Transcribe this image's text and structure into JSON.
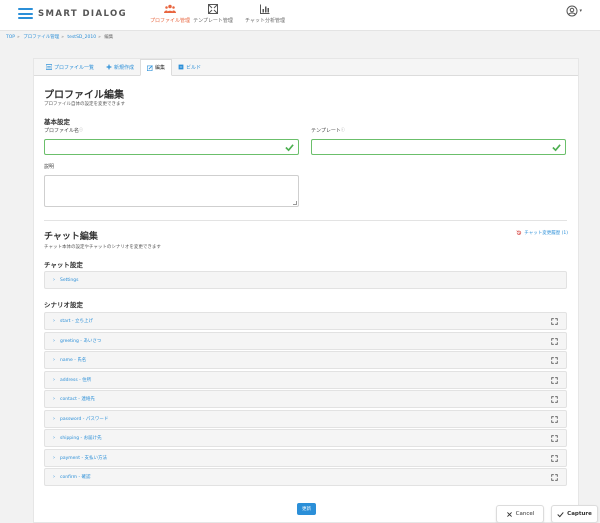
{
  "header": {
    "logo_text": "SMART DIALOG",
    "nav": [
      {
        "label": "プロファイル管理",
        "icon": "users-icon",
        "active": true
      },
      {
        "label": "テンプレート管理",
        "icon": "template-icon",
        "active": false
      },
      {
        "label": "チャット分析管理",
        "icon": "chart-icon",
        "active": false
      }
    ],
    "user_icon": "user-circle-icon",
    "accent_color": "#e8653f",
    "link_color": "#2b8fd8"
  },
  "breadcrumb": {
    "items": [
      "TOP",
      "プロファイル管理",
      "testSD_2010",
      "編集"
    ],
    "separator": "»"
  },
  "tabs": [
    {
      "label": "プロファイル一覧",
      "icon": "list-icon"
    },
    {
      "label": "新規作成",
      "icon": "plus-icon"
    },
    {
      "label": "編集",
      "icon": "edit-icon",
      "active": true
    },
    {
      "label": "ビルド",
      "icon": "build-icon"
    }
  ],
  "profile": {
    "title": "プロファイル編集",
    "description": "プロファイル自体の設定を変更できます",
    "basic_settings": "基本設定",
    "name_label": "プロファイル名",
    "template_label": "テンプレート",
    "info_mark": "ⓘ",
    "name_value": "",
    "template_value": "",
    "desc_label": "説明",
    "desc_value": ""
  },
  "chat": {
    "title": "チャット編集",
    "description": "チャット本体の設定やチャットのシナリオを変更できます",
    "history_label": "チャット変更履歴 (1)",
    "chat_settings": "チャット設定",
    "settings_item": "Settings",
    "scenario_settings": "シナリオ設定",
    "scenarios": [
      "start - 立ち上げ",
      "greeting - あいさつ",
      "name - 氏名",
      "address - 住所",
      "contact - 連絡先",
      "password - パスワード",
      "shipping - お届け先",
      "payment - 支払い方法",
      "confirm - 確認"
    ]
  },
  "actions": {
    "update_label": "更新",
    "cancel_label": "Cancel",
    "capture_label": "Capture"
  }
}
